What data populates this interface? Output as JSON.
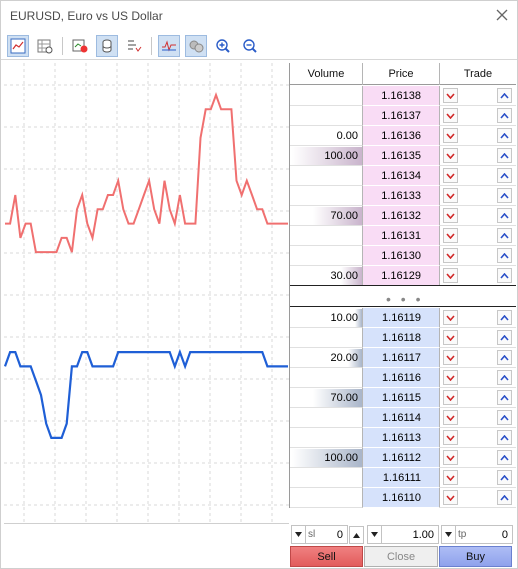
{
  "window": {
    "title": "EURUSD, Euro vs US Dollar"
  },
  "toolbar": {
    "buttons": [
      "chart-mode-icon",
      "table-mode-icon",
      "one-click-trading-icon",
      "volumes-icon",
      "settings-icon",
      "tick-chart-icon",
      "trade-levels-icon",
      "zoom-in-icon",
      "zoom-out-icon"
    ]
  },
  "colors": {
    "ask_line": "#f07070",
    "bid_line": "#1f5fd6",
    "ask_price_bg": "#f9dcf5",
    "bid_price_bg": "#d6e2fb",
    "ask_volume_bar": "#c9b4cc",
    "bid_volume_bar": "#a9b5c9"
  },
  "dom": {
    "headers": {
      "volume": "Volume",
      "price": "Price",
      "trade": "Trade"
    },
    "ask_rows": [
      {
        "volume": "",
        "price": "1.16138",
        "bar": 0
      },
      {
        "volume": "",
        "price": "1.16137",
        "bar": 0
      },
      {
        "volume": "0.00",
        "price": "1.16136",
        "bar": 0
      },
      {
        "volume": "100.00",
        "price": "1.16135",
        "bar": 1.0
      },
      {
        "volume": "",
        "price": "1.16134",
        "bar": 0
      },
      {
        "volume": "",
        "price": "1.16133",
        "bar": 0
      },
      {
        "volume": "70.00",
        "price": "1.16132",
        "bar": 0.7
      },
      {
        "volume": "",
        "price": "1.16131",
        "bar": 0
      },
      {
        "volume": "",
        "price": "1.16130",
        "bar": 0
      },
      {
        "volume": "30.00",
        "price": "1.16129",
        "bar": 0.3
      }
    ],
    "divider": "• • •",
    "bid_rows": [
      {
        "volume": "10.00",
        "price": "1.16119",
        "bar": 0.1
      },
      {
        "volume": "",
        "price": "1.16118",
        "bar": 0
      },
      {
        "volume": "20.00",
        "price": "1.16117",
        "bar": 0.2
      },
      {
        "volume": "",
        "price": "1.16116",
        "bar": 0
      },
      {
        "volume": "70.00",
        "price": "1.16115",
        "bar": 0.7
      },
      {
        "volume": "",
        "price": "1.16114",
        "bar": 0
      },
      {
        "volume": "",
        "price": "1.16113",
        "bar": 0
      },
      {
        "volume": "100.00",
        "price": "1.16112",
        "bar": 1.0
      },
      {
        "volume": "",
        "price": "1.16111",
        "bar": 0
      },
      {
        "volume": "",
        "price": "1.16110",
        "bar": 0
      }
    ]
  },
  "controls": {
    "sl_label": "sl",
    "sl_value": "0",
    "volume_value": "1.00",
    "tp_label": "tp",
    "tp_value": "0"
  },
  "actions": {
    "sell": "Sell",
    "close": "Close",
    "buy": "Buy"
  },
  "chart_data": {
    "type": "line",
    "series": [
      {
        "values": [
          1.16129,
          1.16129,
          1.16131,
          1.16128,
          1.16129,
          1.16129,
          1.16127,
          1.16127,
          1.16127,
          1.16127,
          1.16127,
          1.16128,
          1.16128,
          1.16127,
          1.1613,
          1.16131,
          1.16129,
          1.16128,
          1.1613,
          1.1613,
          1.16131,
          1.16131,
          1.16132,
          1.1613,
          1.16129,
          1.16129,
          1.1613,
          1.16131,
          1.16132,
          1.1613,
          1.16129,
          1.16132,
          1.1613,
          1.16129,
          1.16131,
          1.16129,
          1.16129,
          1.16129,
          1.16135,
          1.16137,
          1.16137,
          1.16138,
          1.16137,
          1.16137,
          1.16137,
          1.16132,
          1.16131,
          1.16132,
          1.16131,
          1.1613,
          1.1613,
          1.16129,
          1.16129,
          1.16129,
          1.16129,
          1.16129
        ]
      },
      {
        "values": [
          1.16119,
          1.1612,
          1.1612,
          1.16119,
          1.16119,
          1.16119,
          1.16118,
          1.16117,
          1.16115,
          1.16114,
          1.16114,
          1.16114,
          1.16115,
          1.16119,
          1.16119,
          1.1612,
          1.1612,
          1.16119,
          1.16119,
          1.16119,
          1.16119,
          1.16119,
          1.1612,
          1.1612,
          1.1612,
          1.1612,
          1.1612,
          1.1612,
          1.1612,
          1.1612,
          1.1612,
          1.1612,
          1.1612,
          1.16119,
          1.1612,
          1.16119,
          1.1612,
          1.1612,
          1.1612,
          1.1612,
          1.1612,
          1.1612,
          1.1612,
          1.1612,
          1.1612,
          1.1612,
          1.1612,
          1.1612,
          1.1612,
          1.1612,
          1.1612,
          1.16119,
          1.16119,
          1.16119,
          1.16119,
          1.16119
        ]
      }
    ],
    "ylim": [
      1.1611,
      1.16138
    ],
    "grid": true
  }
}
